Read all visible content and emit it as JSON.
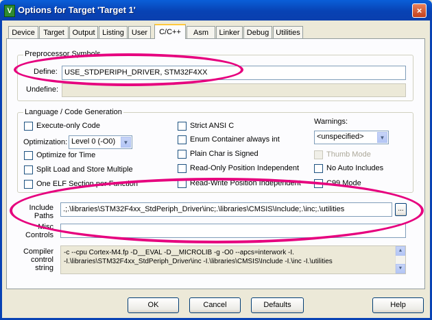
{
  "window": {
    "title": "Options for Target 'Target 1'",
    "close_icon": "×"
  },
  "tabs": [
    {
      "label": "Device"
    },
    {
      "label": "Target"
    },
    {
      "label": "Output"
    },
    {
      "label": "Listing"
    },
    {
      "label": "User"
    },
    {
      "label": "C/C++",
      "active": true
    },
    {
      "label": "Asm"
    },
    {
      "label": "Linker"
    },
    {
      "label": "Debug"
    },
    {
      "label": "Utilities"
    }
  ],
  "preprocessor": {
    "group_label": "Preprocessor Symbols",
    "define_label": "Define:",
    "define_value": "USE_STDPERIPH_DRIVER, STM32F4XX",
    "undefine_label": "Undefine:",
    "undefine_value": ""
  },
  "language": {
    "group_label": "Language / Code Generation",
    "execute_only": "Execute-only Code",
    "optimization_label": "Optimization:",
    "optimization_value": "Level 0 (-O0)",
    "optimize_time": "Optimize for Time",
    "split_load": "Split Load and Store Multiple",
    "one_elf": "One ELF Section per Function",
    "strict_ansi": "Strict ANSI C",
    "enum_container": "Enum Container always int",
    "plain_char": "Plain Char is Signed",
    "ro_pos": "Read-Only Position Independent",
    "rw_pos": "Read-Write Position Independent",
    "warnings_label": "Warnings:",
    "warnings_value": "<unspecified>",
    "thumb_mode": "Thumb Mode",
    "no_auto_includes": "No Auto Includes",
    "c99_mode": "C99 Mode"
  },
  "include": {
    "label_line1": "Include",
    "label_line2": "Paths",
    "value": ".;.\\libraries\\STM32F4xx_StdPeriph_Driver\\inc;.\\libraries\\CMSIS\\Include;.\\inc;.\\utilities",
    "browse": "..."
  },
  "misc": {
    "label_line1": "Misc",
    "label_line2": "Controls",
    "value": ""
  },
  "compiler": {
    "label_line1": "Compiler",
    "label_line2": "control",
    "label_line3": "string",
    "line1": "-c --cpu Cortex-M4.fp -D__EVAL -D__MICROLIB -g -O0 --apcs=interwork -I.",
    "line2": "-I.\\libraries\\STM32F4xx_StdPeriph_Driver\\inc -I.\\libraries\\CMSIS\\Include -I.\\inc -I.\\utilities"
  },
  "buttons": {
    "ok": "OK",
    "cancel": "Cancel",
    "defaults": "Defaults",
    "help": "Help"
  },
  "annotation_color": "#e6007e"
}
